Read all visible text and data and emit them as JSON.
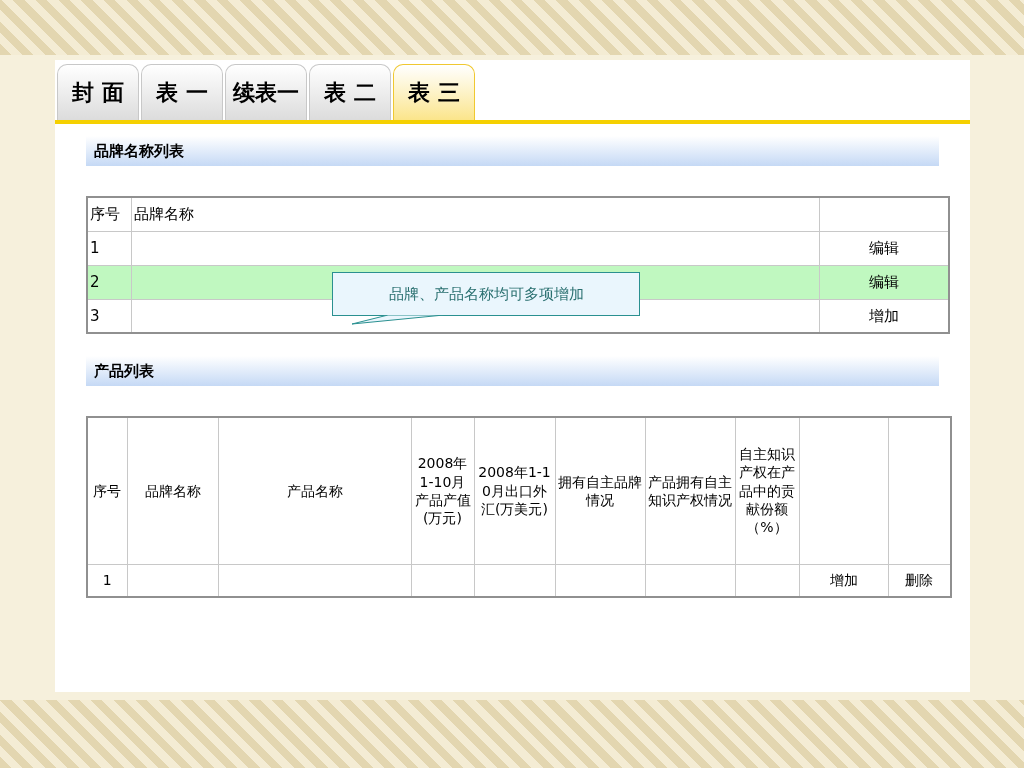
{
  "tabs": [
    {
      "label": "封 面",
      "selected": false
    },
    {
      "label": "表 一",
      "selected": false
    },
    {
      "label": "续表一",
      "selected": false
    },
    {
      "label": "表 二",
      "selected": false
    },
    {
      "label": "表 三",
      "selected": true
    }
  ],
  "brand_list": {
    "title": "品牌名称列表",
    "columns": [
      "序号",
      "品牌名称"
    ],
    "rows": [
      {
        "index": "1",
        "action": "编辑",
        "selected": false
      },
      {
        "index": "2",
        "action": "编辑",
        "selected": true
      },
      {
        "index": "3",
        "action": "增加",
        "selected": false
      }
    ]
  },
  "callout": "品牌、产品名称均可多项增加",
  "product_list": {
    "title": "产品列表",
    "columns": [
      "序号",
      "品牌名称",
      "产品名称",
      "2008年1-10月产品产值(万元)",
      "2008年1-10月出口外汇(万美元)",
      "拥有自主品牌情况",
      "产品拥有自主知识产权情况",
      "自主知识产权在产品中的贡献份额（%）"
    ],
    "rows": [
      {
        "index": "1",
        "actions": [
          "增加",
          "删除"
        ]
      }
    ]
  }
}
